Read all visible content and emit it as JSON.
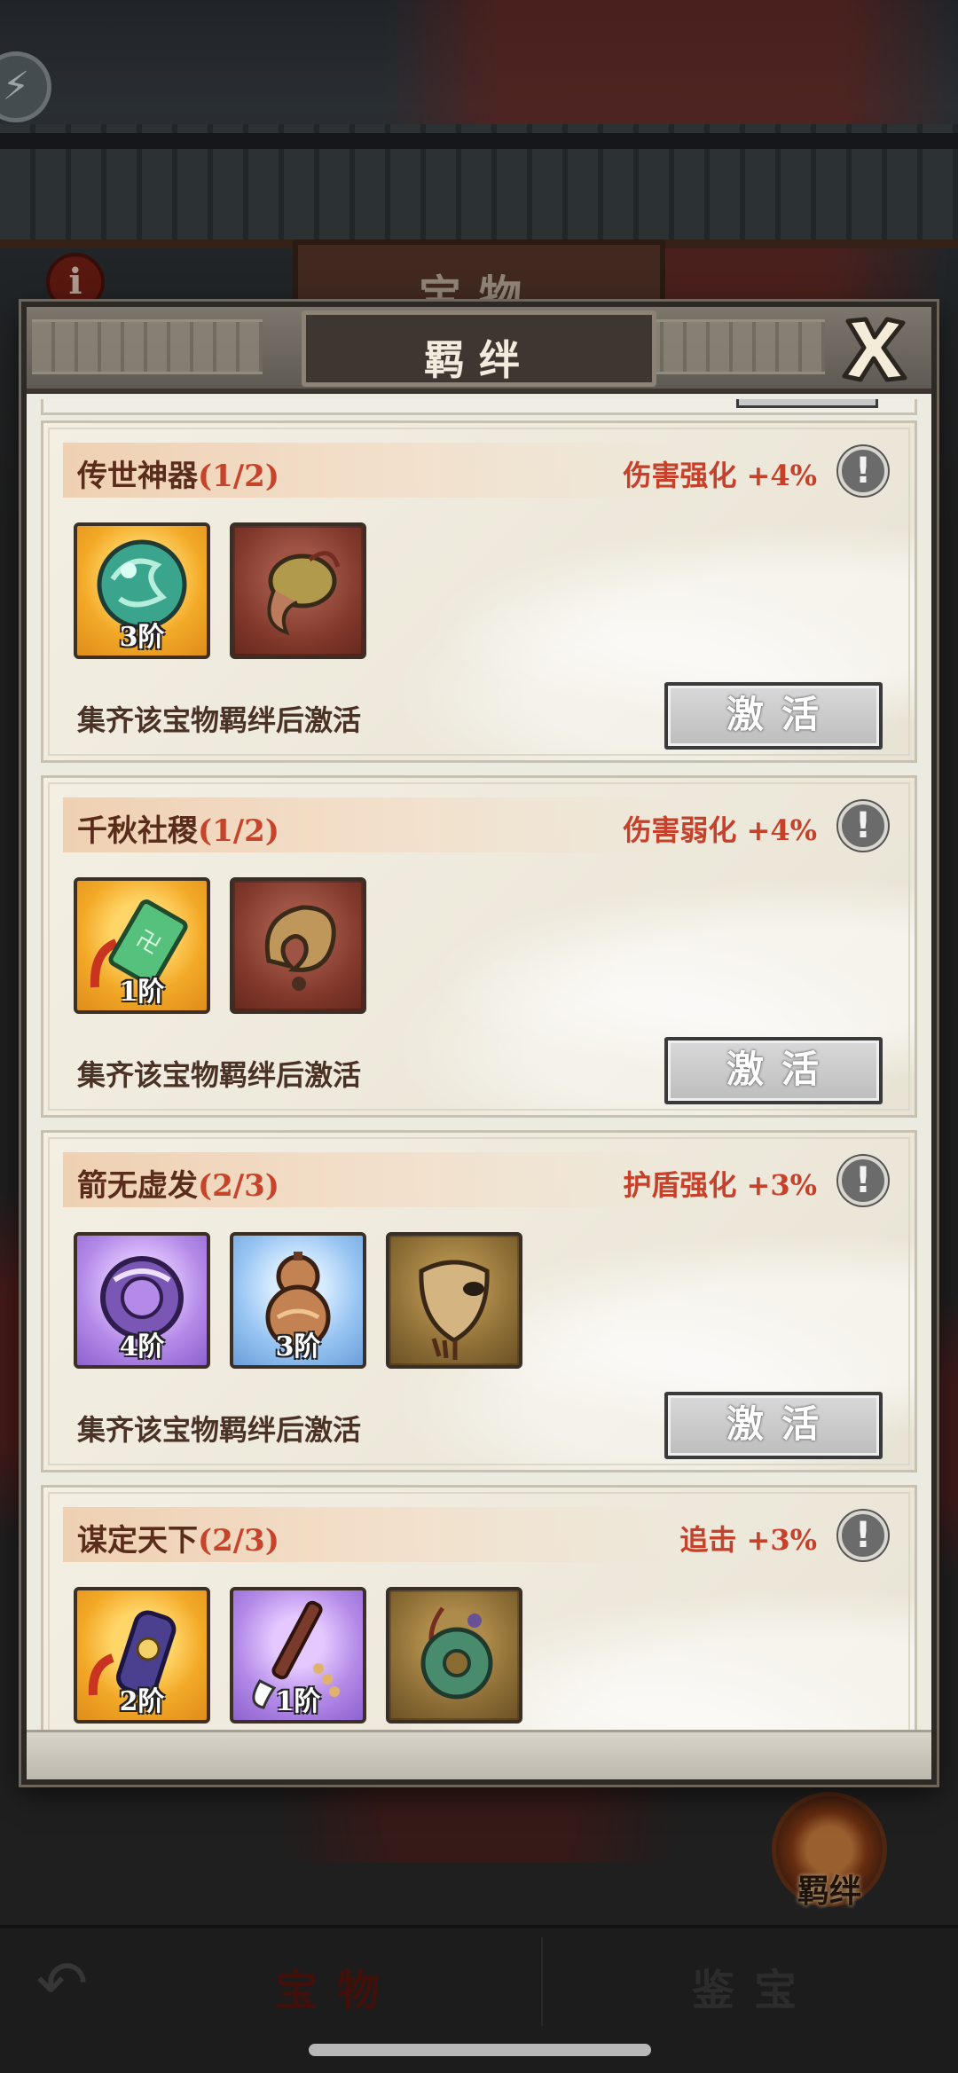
{
  "background": {
    "page_title": "宝物",
    "bond_button_label": "羁绊",
    "bottom_tabs": [
      {
        "label": "宝物",
        "active": true
      },
      {
        "label": "鉴宝",
        "active": false
      }
    ]
  },
  "modal": {
    "title": "羁绊",
    "close_icon": "close-x-icon",
    "cards": [
      {
        "name": "传世神器",
        "progress": "(1/2)",
        "effect": "伤害强化 +4%",
        "hint": "集齐该宝物羁绊后激活",
        "button": "激活",
        "items": [
          {
            "icon": "jade-orb-icon",
            "rarity": "gold",
            "tier": "3阶",
            "owned": true
          },
          {
            "icon": "cloth-pouch-icon",
            "rarity": "red",
            "tier": "",
            "owned": false
          }
        ]
      },
      {
        "name": "千秋社稷",
        "progress": "(1/2)",
        "effect": "伤害弱化 +4%",
        "hint": "集齐该宝物羁绊后激活",
        "button": "激活",
        "items": [
          {
            "icon": "jade-seal-icon",
            "rarity": "gold",
            "tier": "1阶",
            "owned": true
          },
          {
            "icon": "conch-horn-icon",
            "rarity": "red",
            "tier": "",
            "owned": false
          }
        ]
      },
      {
        "name": "箭无虚发",
        "progress": "(2/3)",
        "effect": "护盾强化 +3%",
        "hint": "集齐该宝物羁绊后激活",
        "button": "激活",
        "items": [
          {
            "icon": "jade-ring-icon",
            "rarity": "purple",
            "tier": "4阶",
            "owned": true
          },
          {
            "icon": "gourd-icon",
            "rarity": "blue",
            "tier": "3阶",
            "owned": true
          },
          {
            "icon": "mask-icon",
            "rarity": "brown",
            "tier": "",
            "owned": false
          }
        ]
      },
      {
        "name": "谋定天下",
        "progress": "(2/3)",
        "effect": "追击 +3%",
        "hint": "",
        "button": "",
        "items": [
          {
            "icon": "scroll-icon",
            "rarity": "gold",
            "tier": "2阶",
            "owned": true
          },
          {
            "icon": "brush-icon",
            "rarity": "purple",
            "tier": "1阶",
            "owned": true
          },
          {
            "icon": "jade-pendant-icon",
            "rarity": "brown",
            "tier": "",
            "owned": false
          }
        ]
      }
    ]
  }
}
